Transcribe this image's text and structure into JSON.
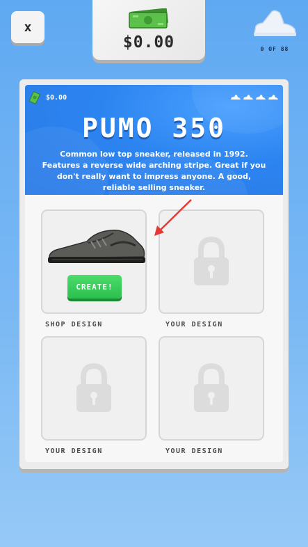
{
  "header": {
    "close_label": "x",
    "money_amount": "$0.00",
    "collection_count": "0 OF 88"
  },
  "card": {
    "banner": {
      "money_amount": "$0.00",
      "shoe_icons": [
        "shoe-icon",
        "shoe-icon",
        "shoe-icon",
        "shoe-icon"
      ],
      "title": "PUMO 350",
      "description": "Common low top sneaker, released in 1992. Features a reverse wide arching stripe. Great if you don't really want to impress anyone. A good, reliable selling sneaker."
    },
    "slots": [
      {
        "label": "SHOP DESIGN",
        "button_label": "CREATE!",
        "locked": false
      },
      {
        "label": "YOUR DESIGN",
        "locked": true
      },
      {
        "label": "YOUR DESIGN",
        "locked": true
      },
      {
        "label": "YOUR DESIGN",
        "locked": true
      }
    ]
  },
  "colors": {
    "background": "#6fb2f3",
    "banner": "#2c84f0",
    "create_button": "#34c452",
    "annotation_arrow": "#e53935"
  }
}
